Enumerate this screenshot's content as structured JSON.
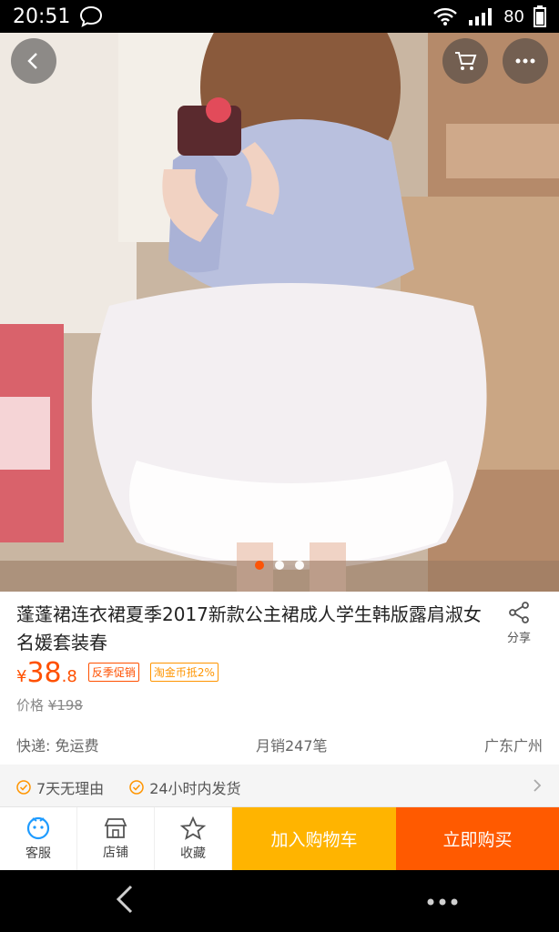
{
  "status_bar": {
    "time": "20:51",
    "battery": "80",
    "icons": [
      "chat-icon",
      "wifi-icon",
      "signal-icon",
      "battery-icon"
    ]
  },
  "hero": {
    "image": "product-photo",
    "page_count": 3,
    "current_page": 1
  },
  "product": {
    "title": "蓬蓬裙连衣裙夏季2017新款公主裙成人学生韩版露肩淑女名媛套装春",
    "share_label": "分享",
    "currency": "¥",
    "price_int": "38",
    "price_dec": ".8",
    "tags": [
      "反季促销",
      "淘金币抵2%"
    ],
    "original_label": "价格",
    "original_price": "¥198"
  },
  "shipping": {
    "delivery": "快递: 免运费",
    "monthly_sales": "月销247笔",
    "location": "广东广州"
  },
  "guarantees": [
    "7天无理由",
    "24小时内发货"
  ],
  "actions": {
    "service": "客服",
    "shop": "店铺",
    "favorite": "收藏",
    "add_to_cart": "加入购物车",
    "buy_now": "立即购买"
  },
  "colors": {
    "accent": "#ff5000",
    "cart_button": "#ffb400",
    "buy_button": "#ff5a00"
  }
}
